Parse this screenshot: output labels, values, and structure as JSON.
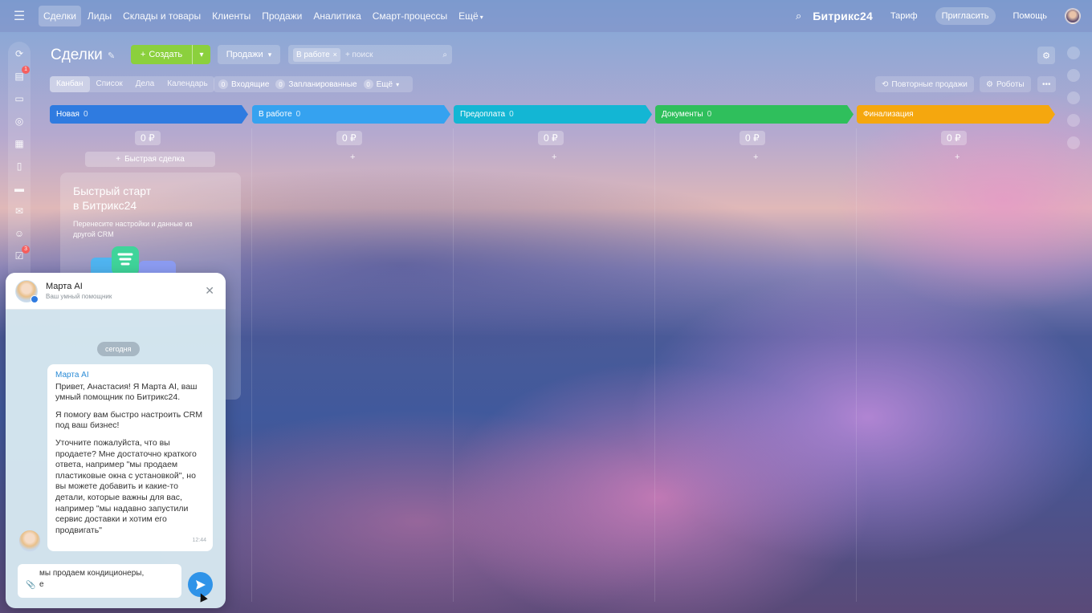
{
  "nav": {
    "items": [
      "Сделки",
      "Лиды",
      "Склады и товары",
      "Клиенты",
      "Продажи",
      "Аналитика",
      "Смарт-процессы",
      "Ещё"
    ],
    "active": 0
  },
  "top_right": {
    "brand": "Битрикс24",
    "tariff": "Тариф",
    "invite": "Пригласить",
    "help": "Помощь"
  },
  "sidebar_badges": {
    "b1": "1",
    "b2": "3"
  },
  "toolbar": {
    "title": "Сделки",
    "create": "Создать",
    "sales": "Продажи",
    "filter_chip": "В работе",
    "search_placeholder": "+ поиск"
  },
  "views": [
    "Канбан",
    "Список",
    "Дела",
    "Календарь"
  ],
  "counters": [
    {
      "count": "0",
      "label": "Входящие"
    },
    {
      "count": "0",
      "label": "Запланированные"
    },
    {
      "count": "0",
      "label": "Ещё"
    }
  ],
  "right_buttons": {
    "repeat": "Повторные продажи",
    "robots": "Роботы"
  },
  "stages": [
    {
      "name": "Новая",
      "count": "0",
      "color": "#2f7be0",
      "sum": "0 ₽"
    },
    {
      "name": "В работе",
      "count": "0",
      "color": "#35a2f0",
      "sum": "0 ₽"
    },
    {
      "name": "Предоплата",
      "count": "0",
      "color": "#13b6d4",
      "sum": "0 ₽"
    },
    {
      "name": "Документы",
      "count": "0",
      "color": "#2fbf5c",
      "sum": "0 ₽"
    },
    {
      "name": "Финализация",
      "count": "",
      "color": "#f5a70e",
      "sum": "0 ₽"
    }
  ],
  "quick_deal": "Быстрая сделка",
  "quick_start": {
    "title_line1": "Быстрый старт",
    "title_line2": "в Битрикс24",
    "text": "Перенесите настройки и данные из другой CRM"
  },
  "chat": {
    "name": "Марта AI",
    "subtitle": "Ваш умный помощник",
    "date": "сегодня",
    "sender": "Марта AI",
    "p1": "Привет, Анастасия! Я Марта AI, ваш умный помощник по Битрикс24.",
    "p2": "Я помогу вам быстро настроить CRM под ваш бизнес!",
    "p3": "Уточните пожалуйста, что вы продаете? Мне достаточно краткого ответа, например \"мы продаем пластиковые окна с установкой\", но вы можете добавить и какие-то детали, которые важны для вас, например \"мы надавно запустили сервис доставки и хотим его продвигать\"",
    "time": "12:44",
    "input_line1": "мы продаем кондиционеры,",
    "input_line2": "е"
  }
}
